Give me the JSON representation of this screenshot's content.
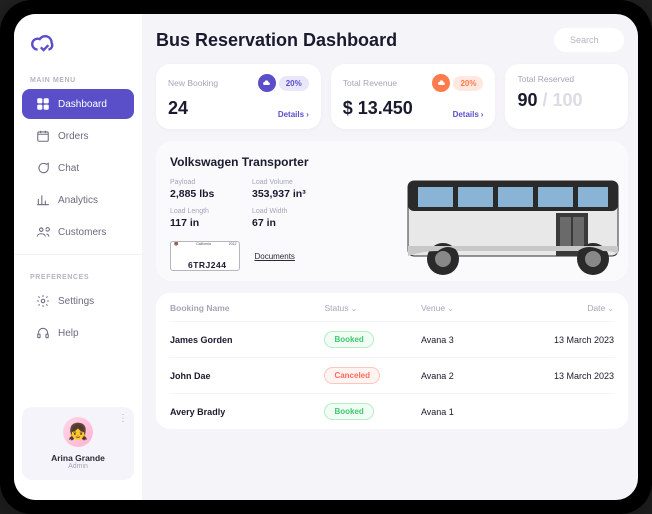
{
  "sidebar": {
    "section_main": "MAIN MENU",
    "section_prefs": "PREFERENCES",
    "items": [
      {
        "label": "Dashboard",
        "icon": "grid-icon"
      },
      {
        "label": "Orders",
        "icon": "calendar-icon"
      },
      {
        "label": "Chat",
        "icon": "chat-icon"
      },
      {
        "label": "Analytics",
        "icon": "chart-icon"
      },
      {
        "label": "Customers",
        "icon": "users-icon"
      }
    ],
    "prefs": [
      {
        "label": "Settings",
        "icon": "gear-icon"
      },
      {
        "label": "Help",
        "icon": "headphones-icon"
      }
    ]
  },
  "user": {
    "name": "Arina Grande",
    "role": "Admin"
  },
  "header": {
    "title": "Bus Reservation Dashboard"
  },
  "search": {
    "placeholder": "Search"
  },
  "stats": {
    "new_booking": {
      "label": "New Booking",
      "pct": "20%",
      "value": "24",
      "details": "Details"
    },
    "revenue": {
      "label": "Total Revenue",
      "pct": "20%",
      "value": "$ 13.450",
      "details": "Details"
    },
    "reserved": {
      "label": "Total Reserved",
      "value": "90",
      "total": "/ 100"
    }
  },
  "vehicle": {
    "name": "Volkswagen Transporter",
    "specs": {
      "payload_label": "Payload",
      "payload": "2,885 lbs",
      "volume_label": "Load Volume",
      "volume": "353,937 in³",
      "length_label": "Load Length",
      "length": "117 in",
      "width_label": "Load Width",
      "width": "67 in"
    },
    "plate_state": "California",
    "plate_year": "2012",
    "plate": "6TRJ244",
    "documents": "Documents"
  },
  "table": {
    "head": {
      "name": "Booking Name",
      "status": "Status",
      "venue": "Venue",
      "date": "Date"
    },
    "rows": [
      {
        "name": "James Gorden",
        "status": "Booked",
        "status_class": "booked",
        "venue": "Avana 3",
        "date": "13 March 2023"
      },
      {
        "name": "John Dae",
        "status": "Canceled",
        "status_class": "canceled",
        "venue": "Avana 2",
        "date": "13 March 2023"
      },
      {
        "name": "Avery Bradly",
        "status": "Booked",
        "status_class": "booked",
        "venue": "Avana 1",
        "date": ""
      }
    ]
  }
}
